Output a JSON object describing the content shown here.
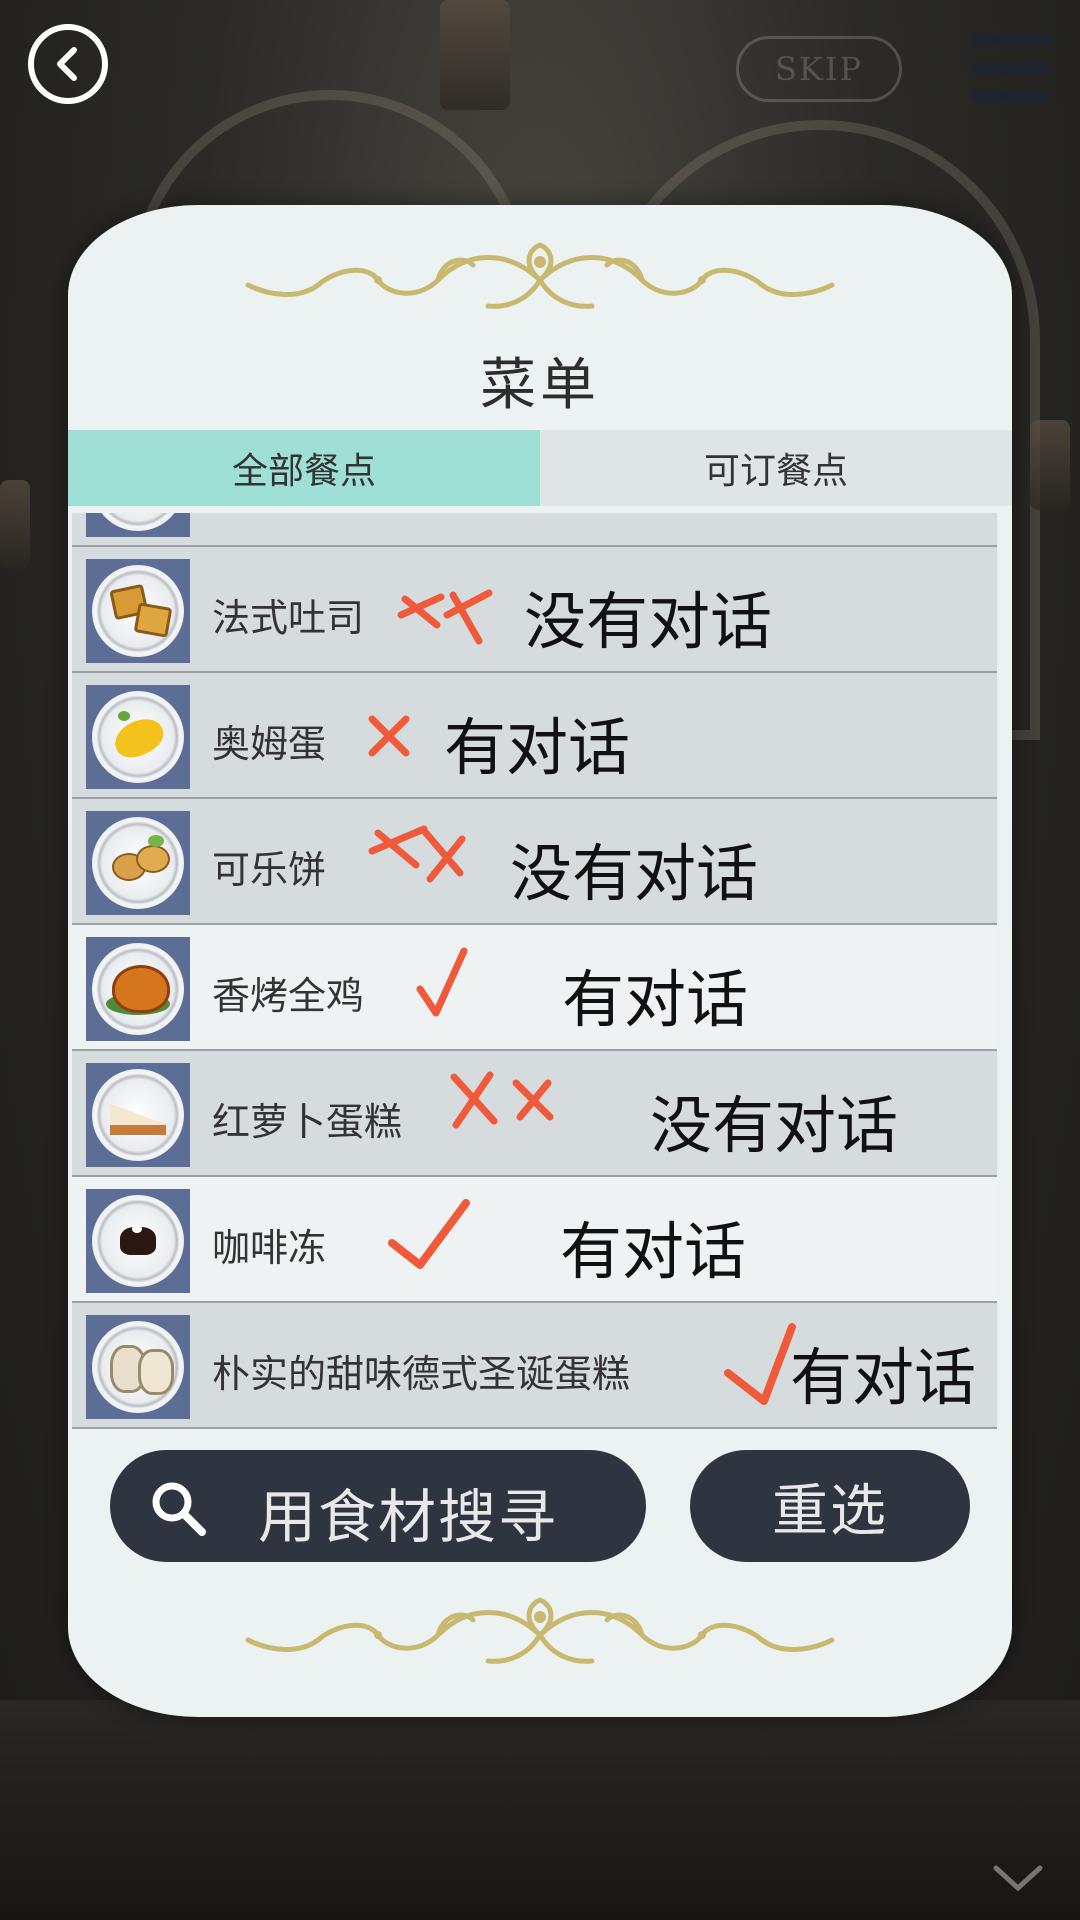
{
  "header": {
    "skip_label": "SKIP"
  },
  "menu": {
    "title": "菜单",
    "tabs": [
      {
        "label": "全部餐点",
        "active": true
      },
      {
        "label": "可订餐点",
        "active": false
      }
    ],
    "items": [
      {
        "name": "法式吐司",
        "mark": "xx",
        "note": "没有对话",
        "food_icon": "french-toast-icon"
      },
      {
        "name": "奥姆蛋",
        "mark": "x",
        "note": "有对话",
        "food_icon": "omelette-icon"
      },
      {
        "name": "可乐饼",
        "mark": "xx",
        "note": "没有对话",
        "food_icon": "croquette-icon"
      },
      {
        "name": "香烤全鸡",
        "mark": "check",
        "note": "有对话",
        "food_icon": "roast-chicken-icon"
      },
      {
        "name": "红萝卜蛋糕",
        "mark": "xx",
        "note": "没有对话",
        "food_icon": "carrot-cake-icon"
      },
      {
        "name": "咖啡冻",
        "mark": "check",
        "note": "有对话",
        "food_icon": "coffee-jelly-icon"
      },
      {
        "name": "朴实的甜味德式圣诞蛋糕",
        "mark": "check",
        "note": "有对话",
        "food_icon": "stollen-icon"
      }
    ],
    "search_label": "用食材搜寻",
    "reset_label": "重选"
  },
  "colors": {
    "tab_active": "#9fe0d6",
    "button_dark": "#2f3441",
    "annotation_mark": "#f05a3a",
    "ornament_gold": "#c9b870"
  }
}
